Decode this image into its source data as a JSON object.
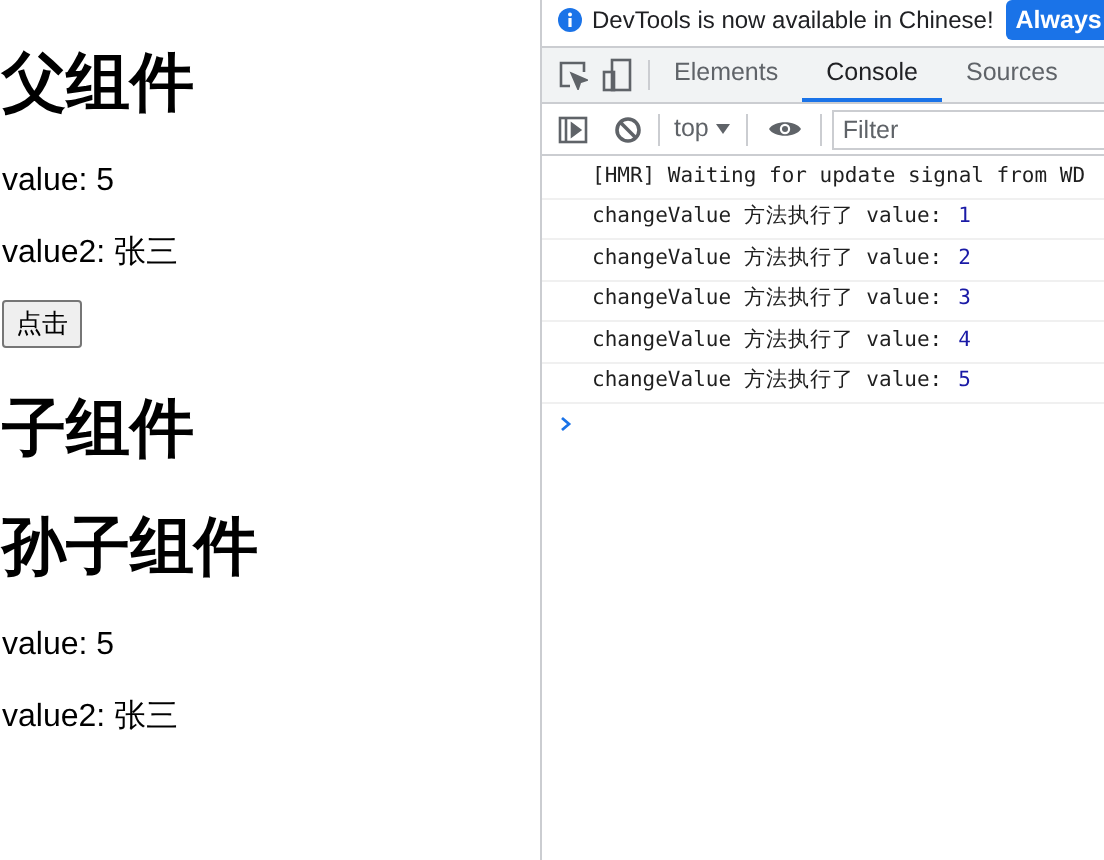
{
  "page": {
    "items": [
      {
        "kind": "heading",
        "text": "父组件"
      },
      {
        "kind": "text",
        "text": "value: 5"
      },
      {
        "kind": "text",
        "text": "value2: 张三"
      },
      {
        "kind": "button",
        "text": "点击"
      },
      {
        "kind": "heading",
        "text": "子组件"
      },
      {
        "kind": "heading",
        "text": "孙子组件"
      },
      {
        "kind": "text",
        "text": "value: 5"
      },
      {
        "kind": "text",
        "text": "value2: 张三"
      }
    ]
  },
  "devtools": {
    "banner": {
      "text": "DevTools is now available in Chinese!",
      "button": "Always"
    },
    "tabs": [
      {
        "label": "Elements",
        "selected": false
      },
      {
        "label": "Console",
        "selected": true
      },
      {
        "label": "Sources",
        "selected": false
      }
    ],
    "context": "top",
    "filter": {
      "placeholder": "Filter"
    },
    "messages": [
      {
        "text": "[HMR] Waiting for update signal from WD"
      },
      {
        "text": "changeValue 方法执行了 value: ",
        "value": "1"
      },
      {
        "text": "changeValue 方法执行了 value: ",
        "value": "2"
      },
      {
        "text": "changeValue 方法执行了 value: ",
        "value": "3"
      },
      {
        "text": "changeValue 方法执行了 value: ",
        "value": "4"
      },
      {
        "text": "changeValue 方法执行了 value: ",
        "value": "5"
      }
    ]
  }
}
